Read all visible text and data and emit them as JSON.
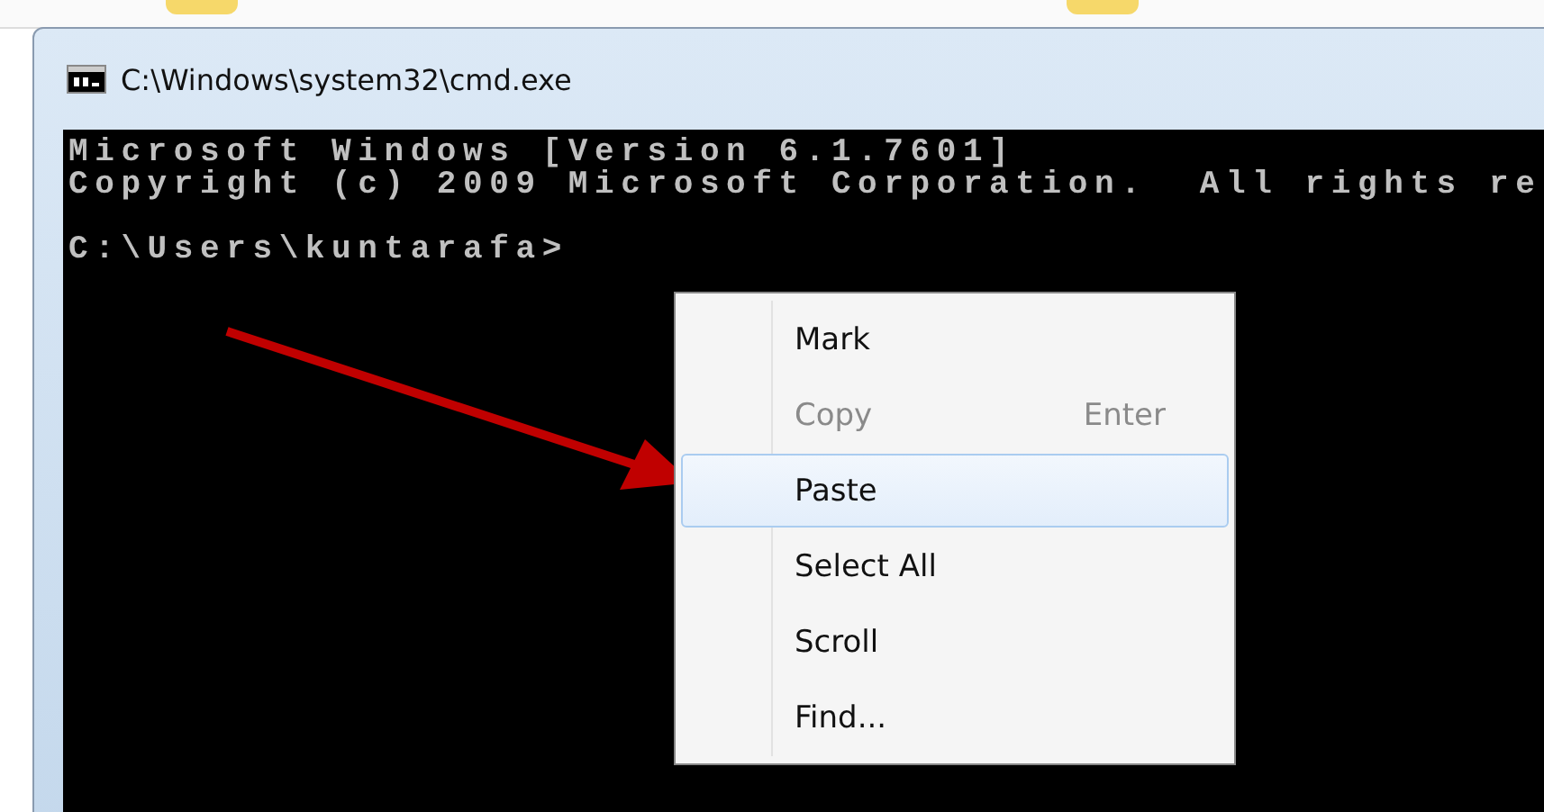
{
  "window": {
    "title": "C:\\Windows\\system32\\cmd.exe"
  },
  "console": {
    "lines": [
      {
        "text": "Microsoft Windows [Version 6.1.7601]",
        "gap_before": false
      },
      {
        "text": "Copyright (c) 2009 Microsoft Corporation.  All rights re",
        "gap_before": false
      },
      {
        "text": "C:\\Users\\kuntarafa>",
        "gap_before": true
      }
    ]
  },
  "context_menu": {
    "items": [
      {
        "label": "Mark",
        "disabled": false,
        "selected": false
      },
      {
        "label": "Copy",
        "shortcut": "Enter",
        "disabled": true,
        "selected": false
      },
      {
        "label": "Paste",
        "disabled": false,
        "selected": true
      },
      {
        "label": "Select All",
        "disabled": false,
        "selected": false
      },
      {
        "label": "Scroll",
        "disabled": false,
        "selected": false
      },
      {
        "label": "Find...",
        "disabled": false,
        "selected": false
      }
    ]
  }
}
